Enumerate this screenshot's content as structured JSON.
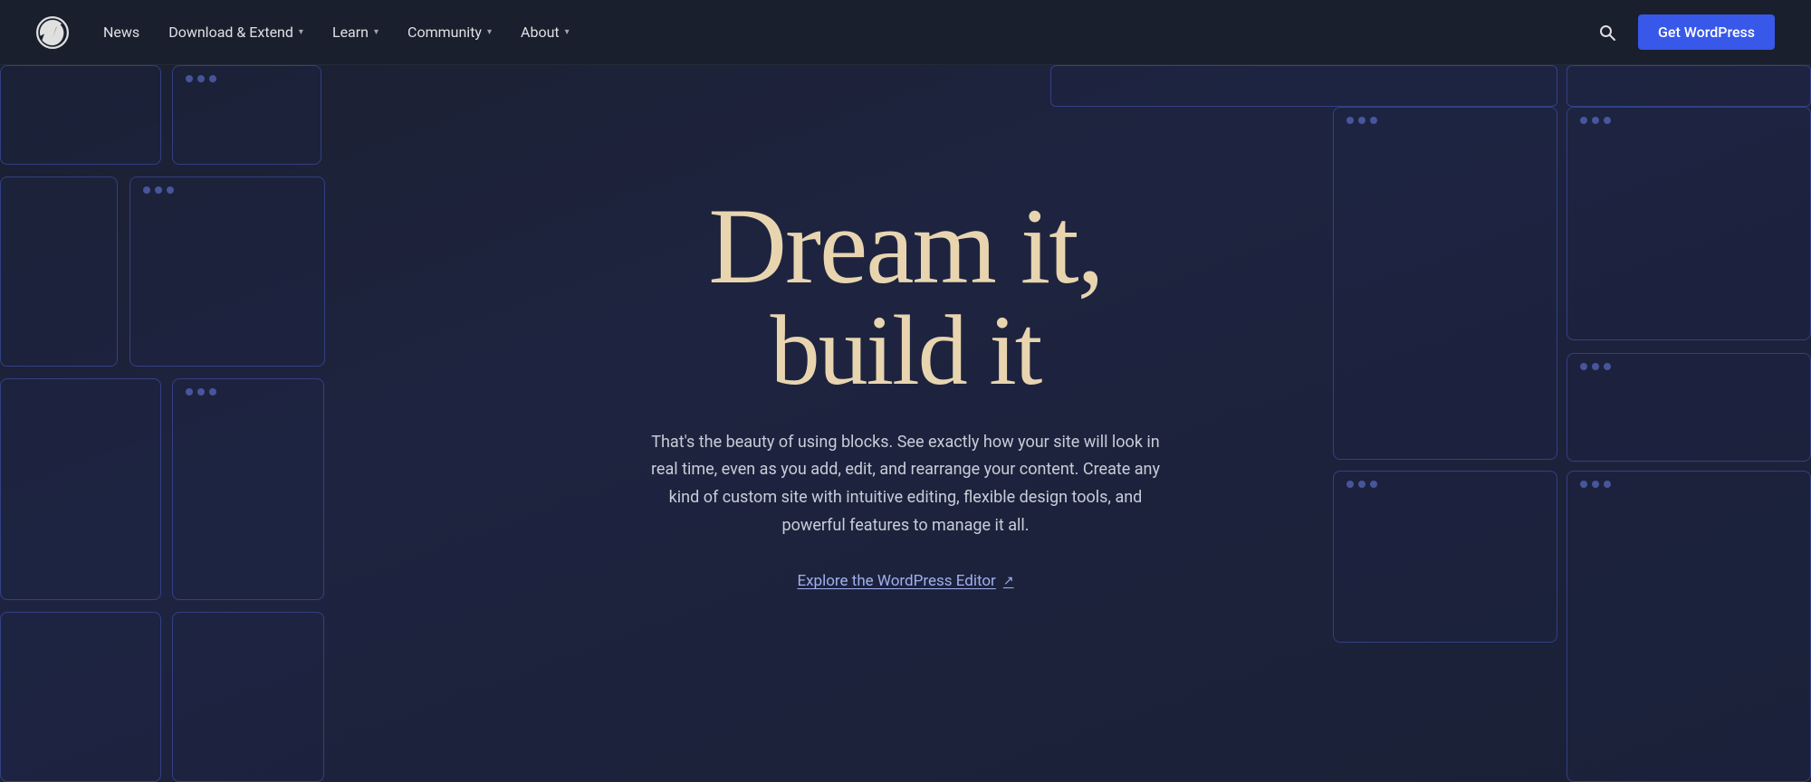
{
  "nav": {
    "logo_alt": "WordPress Logo",
    "items": [
      {
        "label": "News",
        "has_dropdown": false
      },
      {
        "label": "Download & Extend",
        "has_dropdown": true
      },
      {
        "label": "Learn",
        "has_dropdown": true
      },
      {
        "label": "Community",
        "has_dropdown": true
      },
      {
        "label": "About",
        "has_dropdown": true
      }
    ],
    "search_label": "Search",
    "cta_label": "Get WordPress"
  },
  "hero": {
    "title_line1": "Dream it,",
    "title_line2": "build it",
    "description": "That's the beauty of using blocks. See exactly how your site will look in real time, even as you add, edit, and rearrange your content. Create any kind of custom site with intuitive editing, flexible design tools, and powerful features to manage it all.",
    "explore_link_text": "Explore the WordPress Editor",
    "explore_link_icon": "↗"
  },
  "colors": {
    "bg": "#1a1f2e",
    "nav_bg": "#1a1f2e",
    "cta_bg": "#3858e9",
    "title_color": "#e8d5b0",
    "body_text": "#c8cdd8",
    "link_color": "#a0b0f0",
    "block_border": "rgba(80, 100, 220, 0.45)"
  }
}
